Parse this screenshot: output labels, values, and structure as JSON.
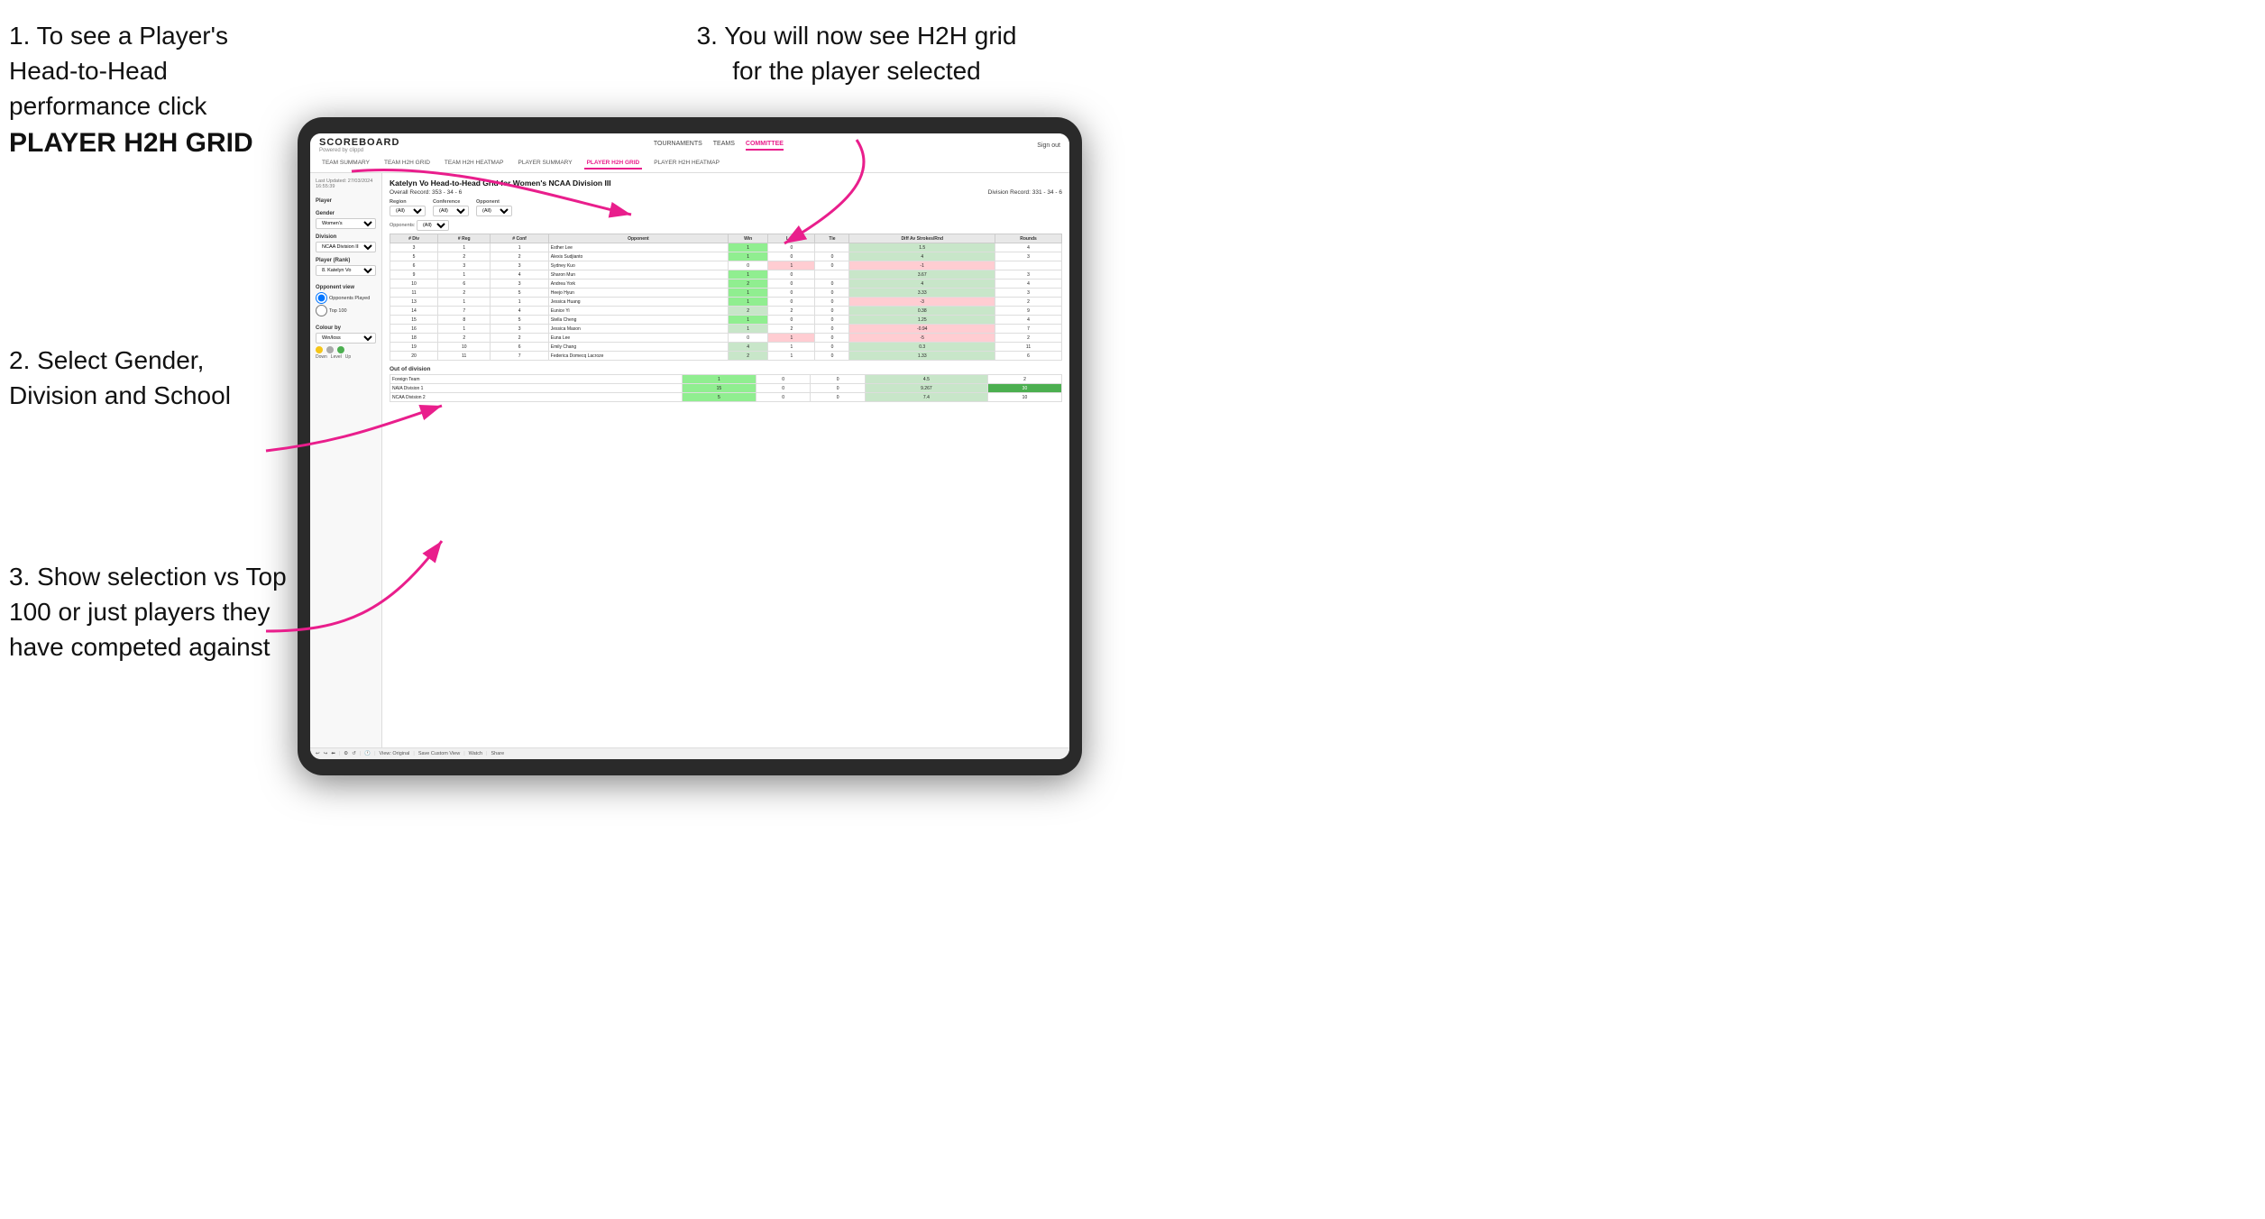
{
  "instructions": {
    "step1_title": "1. To see a Player's Head-to-Head performance click",
    "step1_bold": "PLAYER H2H GRID",
    "step3_top": "3. You will now see H2H grid for the player selected",
    "step2": "2. Select Gender, Division and School",
    "step3_bottom": "3. Show selection vs Top 100 or just players they have competed against"
  },
  "nav": {
    "logo": "SCOREBOARD",
    "logo_sub": "Powered by clippd",
    "links": [
      "TOURNAMENTS",
      "TEAMS",
      "COMMITTEE"
    ],
    "active_link": "COMMITTEE",
    "sub_links": [
      "TEAM SUMMARY",
      "TEAM H2H GRID",
      "TEAM H2H HEATMAP",
      "PLAYER SUMMARY",
      "PLAYER H2H GRID",
      "PLAYER H2H HEATMAP"
    ],
    "active_sub": "PLAYER H2H GRID",
    "sign_out": "Sign out"
  },
  "sidebar": {
    "timestamp": "Last Updated: 27/03/2024",
    "time": "16:55:39",
    "player_label": "Player",
    "gender_label": "Gender",
    "gender_value": "Women's",
    "division_label": "Division",
    "division_value": "NCAA Division III",
    "player_rank_label": "Player (Rank)",
    "player_rank_value": "8. Katelyn Vo",
    "opponent_view_label": "Opponent view",
    "opponents_played": "Opponents Played",
    "top_100": "Top 100",
    "colour_by_label": "Colour by",
    "colour_by_value": "Win/loss",
    "dot_down": "Down",
    "dot_level": "Level",
    "dot_up": "Up"
  },
  "main": {
    "title": "Katelyn Vo Head-to-Head Grid for Women's NCAA Division III",
    "overall_record": "Overall Record: 353 - 34 - 6",
    "division_record": "Division Record: 331 - 34 - 6",
    "region_label": "Region",
    "conference_label": "Conference",
    "opponent_label": "Opponent",
    "opponents_label": "Opponents:",
    "all_filter": "(All)",
    "table_headers": [
      "# Div",
      "# Reg",
      "# Conf",
      "Opponent",
      "Win",
      "Loss",
      "Tie",
      "Diff Av Strokes/Rnd",
      "Rounds"
    ],
    "rows": [
      {
        "div": "3",
        "reg": "1",
        "conf": "1",
        "opponent": "Esther Lee",
        "win": 1,
        "loss": 0,
        "tie": "",
        "diff": 1.5,
        "rounds": 4,
        "color": "green"
      },
      {
        "div": "5",
        "reg": "2",
        "conf": "2",
        "opponent": "Alexis Sudjianto",
        "win": 1,
        "loss": 0,
        "tie": 0,
        "diff": 4.0,
        "rounds": 3,
        "color": "green"
      },
      {
        "div": "6",
        "reg": "3",
        "conf": "3",
        "opponent": "Sydney Kuo",
        "win": 0,
        "loss": 1,
        "tie": 0,
        "diff": -1.0,
        "rounds": "",
        "color": "yellow"
      },
      {
        "div": "9",
        "reg": "1",
        "conf": "4",
        "opponent": "Sharon Mun",
        "win": 1,
        "loss": 0,
        "tie": "",
        "diff": 3.67,
        "rounds": 3,
        "color": "green"
      },
      {
        "div": "10",
        "reg": "6",
        "conf": "3",
        "opponent": "Andrea York",
        "win": 2,
        "loss": 0,
        "tie": 0,
        "diff": 4.0,
        "rounds": 4,
        "color": "green"
      },
      {
        "div": "11",
        "reg": "2",
        "conf": "5",
        "opponent": "Heejo Hyun",
        "win": 1,
        "loss": 0,
        "tie": 0,
        "diff": 3.33,
        "rounds": 3,
        "color": "green"
      },
      {
        "div": "13",
        "reg": "1",
        "conf": "1",
        "opponent": "Jessica Huang",
        "win": 1,
        "loss": 0,
        "tie": 0,
        "diff": -3.0,
        "rounds": 2,
        "color": "yellow"
      },
      {
        "div": "14",
        "reg": "7",
        "conf": "4",
        "opponent": "Eunice Yi",
        "win": 2,
        "loss": 2,
        "tie": 0,
        "diff": 0.38,
        "rounds": 9,
        "color": "light-green"
      },
      {
        "div": "15",
        "reg": "8",
        "conf": "5",
        "opponent": "Stella Cheng",
        "win": 1,
        "loss": 0,
        "tie": 0,
        "diff": 1.25,
        "rounds": 4,
        "color": "green"
      },
      {
        "div": "16",
        "reg": "1",
        "conf": "3",
        "opponent": "Jessica Mason",
        "win": 1,
        "loss": 2,
        "tie": 0,
        "diff": -0.94,
        "rounds": 7,
        "color": "yellow"
      },
      {
        "div": "18",
        "reg": "2",
        "conf": "2",
        "opponent": "Euna Lee",
        "win": 0,
        "loss": 1,
        "tie": 0,
        "diff": -5.0,
        "rounds": 2,
        "color": "yellow"
      },
      {
        "div": "19",
        "reg": "10",
        "conf": "6",
        "opponent": "Emily Chang",
        "win": 4,
        "loss": 1,
        "tie": 0,
        "diff": 0.3,
        "rounds": 11,
        "color": "light-green"
      },
      {
        "div": "20",
        "reg": "11",
        "conf": "7",
        "opponent": "Federica Domecq Lacroze",
        "win": 2,
        "loss": 1,
        "tie": 0,
        "diff": 1.33,
        "rounds": 6,
        "color": "green"
      }
    ],
    "out_of_division": "Out of division",
    "ood_rows": [
      {
        "label": "Foreign Team",
        "win": 1,
        "loss": 0,
        "tie": 0,
        "diff": 4.5,
        "rounds": 2,
        "color": ""
      },
      {
        "label": "NAIA Division 1",
        "win": 15,
        "loss": 0,
        "tie": 0,
        "diff": 9.267,
        "rounds": 30,
        "color": "green"
      },
      {
        "label": "NCAA Division 2",
        "win": 5,
        "loss": 0,
        "tie": 0,
        "diff": 7.4,
        "rounds": 10,
        "color": ""
      }
    ],
    "toolbar": {
      "view_original": "View: Original",
      "save_custom": "Save Custom View",
      "watch": "Watch",
      "share": "Share"
    }
  }
}
